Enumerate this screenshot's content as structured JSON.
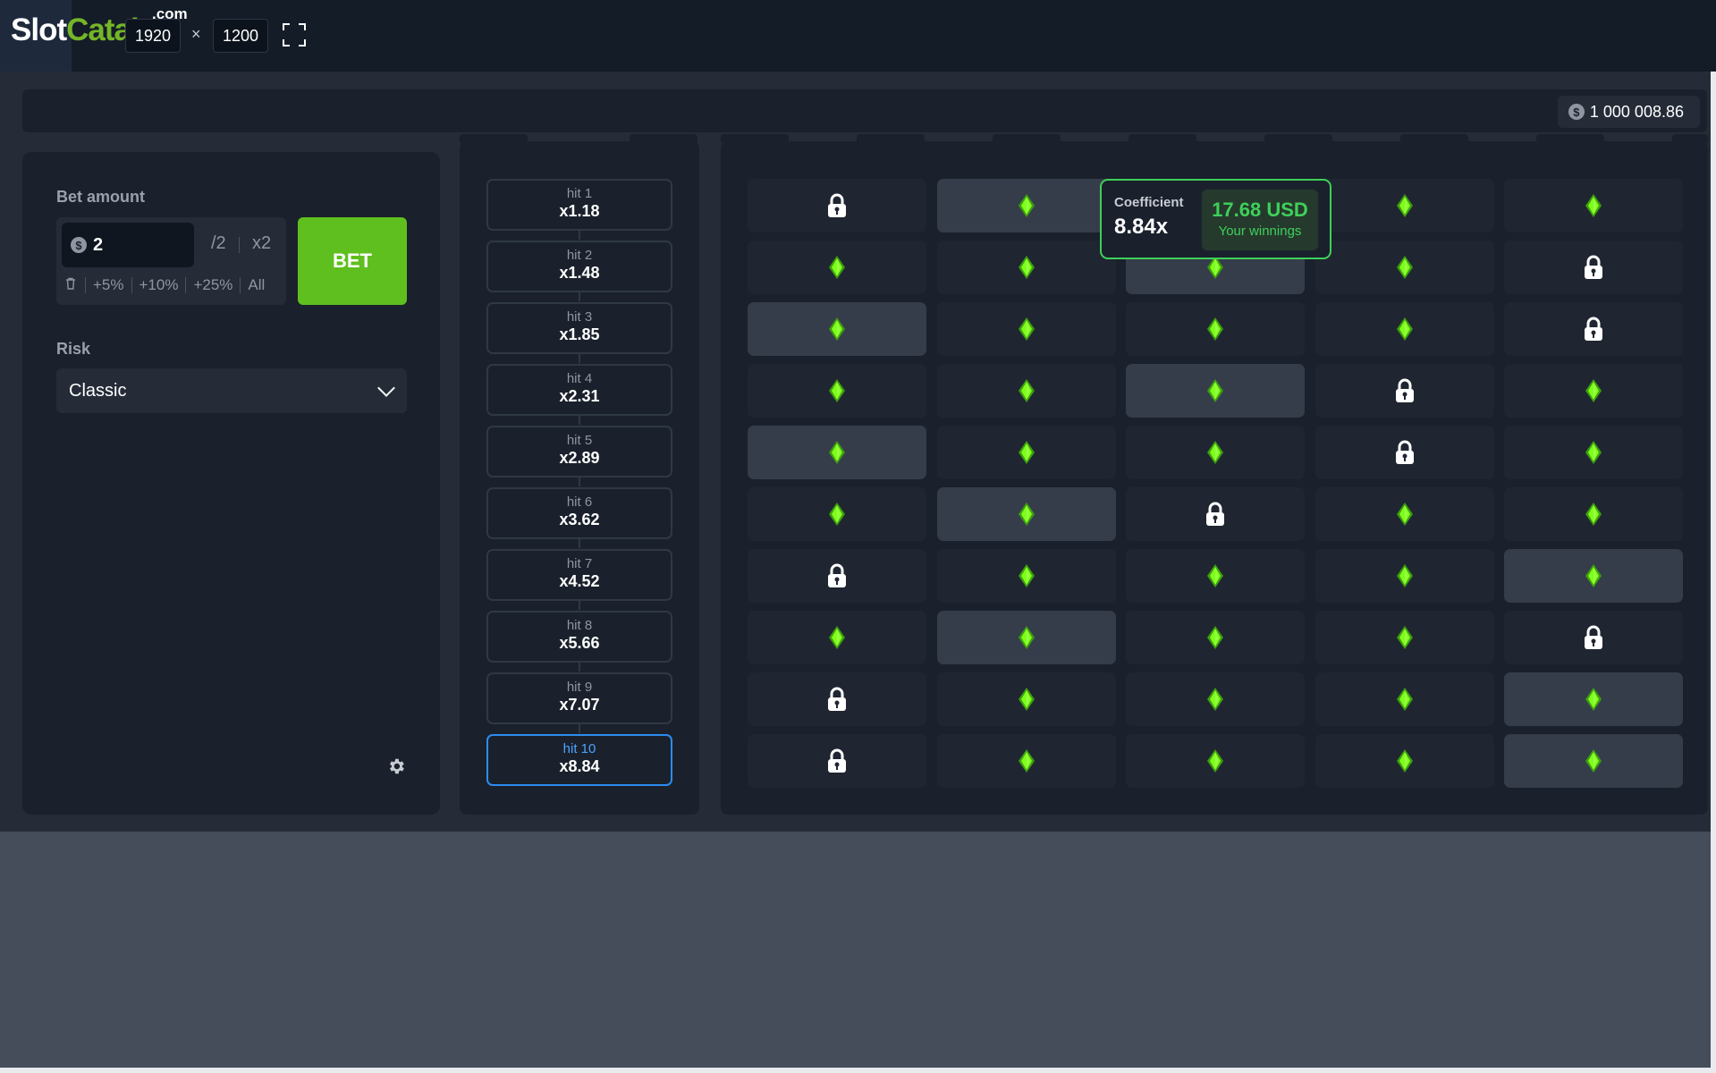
{
  "topbar": {
    "logo_slot": "Slot",
    "logo_catalog": "Catalog",
    "logo_com": ".com",
    "width_value": "1920",
    "times": "×",
    "height_value": "1200"
  },
  "header": {
    "currency_symbol": "$",
    "balance": "1 000 008.86"
  },
  "bet_panel": {
    "bet_amount_label": "Bet amount",
    "currency_symbol": "$",
    "bet_value": "2",
    "half_label": "/2",
    "double_label": "x2",
    "quick": [
      "+5%",
      "+10%",
      "+25%",
      "All"
    ],
    "bet_button": "BET",
    "risk_label": "Risk",
    "risk_value": "Classic"
  },
  "hits": [
    {
      "label": "hit 1",
      "mult": "x1.18"
    },
    {
      "label": "hit 2",
      "mult": "x1.48"
    },
    {
      "label": "hit 3",
      "mult": "x1.85"
    },
    {
      "label": "hit 4",
      "mult": "x2.31"
    },
    {
      "label": "hit 5",
      "mult": "x2.89"
    },
    {
      "label": "hit 6",
      "mult": "x3.62"
    },
    {
      "label": "hit 7",
      "mult": "x4.52"
    },
    {
      "label": "hit 8",
      "mult": "x5.66"
    },
    {
      "label": "hit 9",
      "mult": "x7.07"
    },
    {
      "label": "hit 10",
      "mult": "x8.84"
    }
  ],
  "active_hit": 10,
  "board": {
    "rows": [
      [
        "lock",
        "gem",
        "gem",
        "gem",
        "gem"
      ],
      [
        "gem",
        "gem",
        "gem",
        "gem",
        "lock"
      ],
      [
        "gem",
        "gem",
        "gem",
        "gem",
        "lock"
      ],
      [
        "gem",
        "gem",
        "gem",
        "lock",
        "gem"
      ],
      [
        "gem",
        "gem",
        "gem",
        "lock",
        "gem"
      ],
      [
        "gem",
        "gem",
        "lock",
        "gem",
        "gem"
      ],
      [
        "lock",
        "gem",
        "gem",
        "gem",
        "gem"
      ],
      [
        "gem",
        "gem",
        "gem",
        "gem",
        "lock"
      ],
      [
        "lock",
        "gem",
        "gem",
        "gem",
        "gem"
      ],
      [
        "lock",
        "gem",
        "gem",
        "gem",
        "gem"
      ]
    ],
    "picked": [
      1,
      2,
      0,
      2,
      0,
      1,
      4,
      1,
      4,
      4
    ]
  },
  "popup": {
    "coefficient_label": "Coefficient",
    "coefficient_value": "8.84x",
    "winnings_amount": "17.68 USD",
    "winnings_label": "Your winnings"
  },
  "colors": {
    "gem": "#7cff1a",
    "bet_button": "#5fbf1f",
    "accent_blue": "#2d8cf0",
    "win_green": "#3ed05a"
  }
}
